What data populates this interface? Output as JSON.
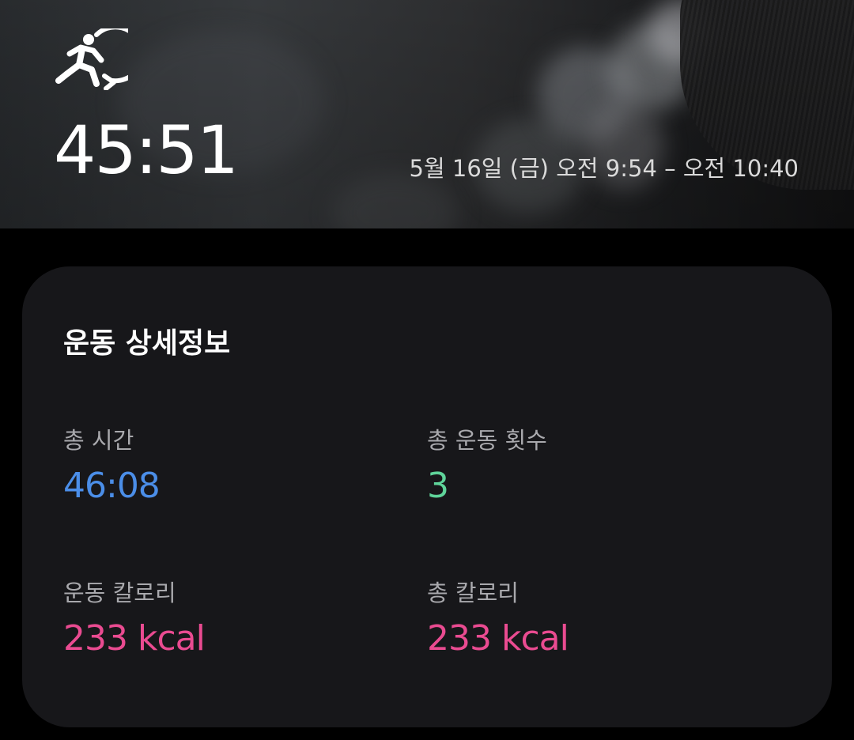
{
  "header": {
    "icon": "running-person-icon",
    "duration": "45:51",
    "time_range": "5월 16일 (금) 오전 9:54 – 오전 10:40"
  },
  "details": {
    "title": "운동 상세정보",
    "stats": [
      {
        "label": "총 시간",
        "value": "46:08",
        "color": "#4b8ee8"
      },
      {
        "label": "총 운동 횟수",
        "value": "3",
        "color": "#5fd49a"
      },
      {
        "label": "운동 칼로리",
        "value": "233 kcal",
        "color": "#ea4b91"
      },
      {
        "label": "총 칼로리",
        "value": "233 kcal",
        "color": "#ea4b91"
      }
    ]
  },
  "colors": {
    "background": "#000000",
    "card": "#17171a",
    "label": "#a9a9ad"
  }
}
